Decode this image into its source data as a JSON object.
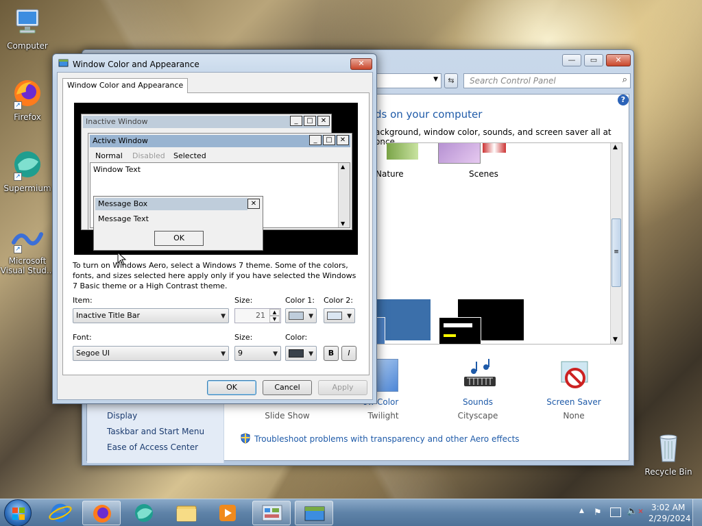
{
  "desktop": {
    "icons": [
      {
        "label": "Computer"
      },
      {
        "label": "Firefox"
      },
      {
        "label": "Supermium"
      },
      {
        "label": "Microsoft Visual Stud..."
      },
      {
        "label": "Recycle Bin"
      }
    ]
  },
  "control_panel": {
    "search_placeholder": "Search Control Panel",
    "heading": "ds on your computer",
    "description": "ackground, window color, sounds, and screen saver all at once.",
    "themes": [
      {
        "label": "Nature"
      },
      {
        "label": "Scenes"
      }
    ],
    "bottom_items": [
      {
        "title": "ow Color",
        "value": "Twilight"
      },
      {
        "title": "Sounds",
        "value": "Cityscape"
      },
      {
        "title": "Screen Saver",
        "value": "None"
      }
    ],
    "desktop_bg_value": "Slide Show",
    "sidebar": [
      "Display",
      "Taskbar and Start Menu",
      "Ease of Access Center"
    ],
    "troubleshoot_link": "Troubleshoot problems with transparency and other Aero effects"
  },
  "dialog": {
    "title": "Window Color and Appearance",
    "tab": "Window Color and Appearance",
    "preview": {
      "inactive_title": "Inactive Window",
      "active_title": "Active Window",
      "menu": [
        "Normal",
        "Disabled",
        "Selected"
      ],
      "window_text": "Window Text",
      "msgbox_title": "Message Box",
      "msgbox_text": "Message Text",
      "ok": "OK"
    },
    "info": "To turn on Windows Aero, select a Windows 7 theme.  Some of the colors, fonts, and sizes selected here apply only if you have selected the Windows 7 Basic theme or a High Contrast theme.",
    "item_label": "Item:",
    "item_value": "Inactive Title Bar",
    "size_label": "Size:",
    "size_value": "21",
    "color1_label": "Color 1:",
    "color2_label": "Color 2:",
    "font_label": "Font:",
    "font_value": "Segoe UI",
    "font_size_label": "Size:",
    "font_size_value": "9",
    "font_color_label": "Color:",
    "bold": "B",
    "italic": "I",
    "buttons": {
      "ok": "OK",
      "cancel": "Cancel",
      "apply": "Apply"
    }
  },
  "taskbar": {
    "time": "3:02 AM",
    "date": "2/29/2024"
  },
  "colors": {
    "inactive_title": "#bfcddb",
    "active_title": "#99b4d1",
    "link": "#1e5aa8"
  }
}
